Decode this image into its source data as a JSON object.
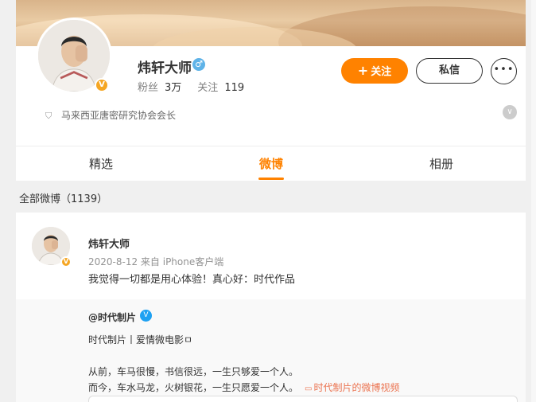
{
  "profile": {
    "name": "炜轩大师",
    "gender_icon": "male-icon",
    "fans_label": "粉丝",
    "fans_count": "3万",
    "following_label": "关注",
    "following_count": "119",
    "follow_button": "关注",
    "message_button": "私信",
    "more_button": "•••",
    "bio": "马来西亚唐密研究协会会长",
    "verified_color": "#f5a623"
  },
  "tabs": [
    {
      "label": "精选"
    },
    {
      "label": "微博",
      "active": true
    },
    {
      "label": "相册"
    }
  ],
  "feed": {
    "all_count_label": "全部微博（1139）"
  },
  "post": {
    "author": "炜轩大师",
    "meta": "2020-8-12 来自 iPhone客户端",
    "text": "我觉得一切都是用心体验！真心好：时代作品",
    "repost": {
      "user": "@时代制片",
      "line1": "时代制片丨爱情微电影ㅁ",
      "line2": "从前，车马很慢，书信很远，一生只够爱一个人。",
      "line3": "而今，车水马龙，火树银花，一生只愿爱一个人。",
      "video_link": "时代制片的微博视频"
    }
  },
  "colors": {
    "accent": "#ff8200",
    "link": "#eb7350",
    "verified_blue": "#1ea1f2"
  }
}
